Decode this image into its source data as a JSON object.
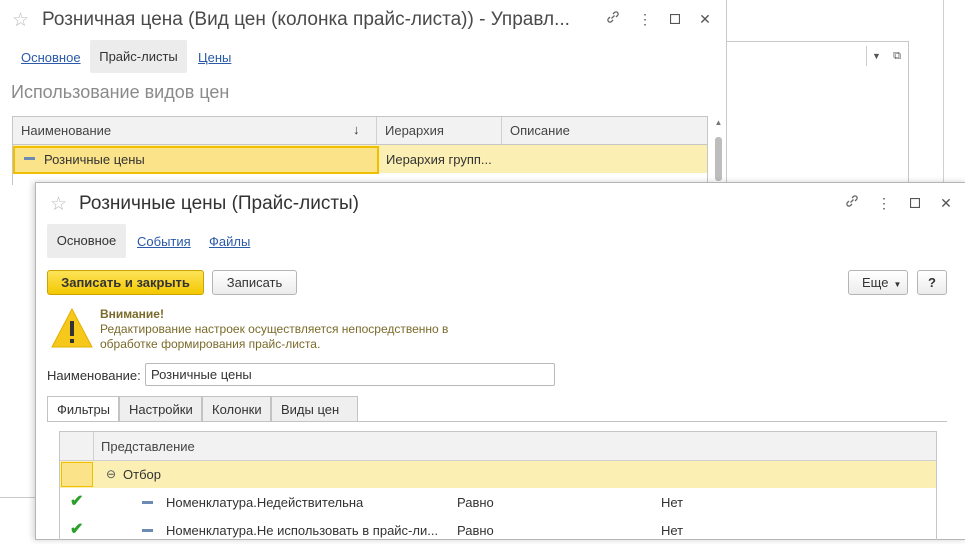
{
  "bg_window": {
    "title": "Розничная цена (Вид цен (колонка прайс-листа)) - Управл...",
    "tabs": [
      "Основное",
      "Прайс-листы",
      "Цены"
    ],
    "section_title": "Использование видов цен",
    "table": {
      "columns": [
        "Наименование",
        "Иерархия",
        "Описание"
      ],
      "sort_indicator": "↓",
      "rows": [
        {
          "name": "Розничные цены",
          "hierarchy": "Иерархия групп...",
          "description": ""
        }
      ]
    }
  },
  "dialog": {
    "title": "Розничные цены (Прайс-листы)",
    "tabs": [
      "Основное",
      "События",
      "Файлы"
    ],
    "buttons": {
      "save_close": "Записать и закрыть",
      "save": "Записать",
      "more": "Еще",
      "help": "?"
    },
    "warning": {
      "title": "Внимание!",
      "line1": "Редактирование настроек осуществляется непосредственно в",
      "line2": "обработке формирования прайс-листа."
    },
    "name_label": "Наименование:",
    "name_value": "Розничные цены",
    "inner_tabs": [
      "Фильтры",
      "Настройки",
      "Колонки",
      "Виды цен"
    ],
    "filter_table": {
      "column": "Представление",
      "group": "Отбор",
      "rows": [
        {
          "field": "Номенклатура.Недействительна",
          "condition": "Равно",
          "value": "Нет"
        },
        {
          "field": "Номенклатура.Не использовать в прайс-ли...",
          "condition": "Равно",
          "value": "Нет"
        }
      ]
    }
  },
  "icons": {
    "favorite": "star-icon",
    "link": "link-icon",
    "menu": "more-vertical-icon",
    "maximize": "maximize-icon",
    "close": "close-icon",
    "warning": "warning-triangle-icon",
    "check": "checkmark-icon"
  },
  "colors": {
    "primary_button": "#f3c800",
    "selected_row": "#fbefb4",
    "link": "#2a5aa8",
    "warning_text": "#7a6a2a"
  }
}
